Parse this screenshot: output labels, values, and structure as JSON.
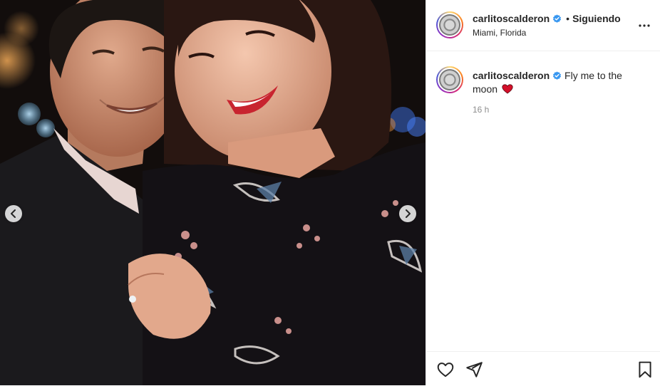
{
  "post": {
    "photo_alt": "Couple smiling at night",
    "prev_icon": "chevron-left-icon",
    "next_icon": "chevron-right-icon"
  },
  "header": {
    "username": "carlitoscalderon",
    "separator": "•",
    "follow_status": "Siguiendo",
    "location": "Miami, Florida",
    "more_icon": "more-options-icon"
  },
  "caption": {
    "username": "carlitoscalderon",
    "text": "Fly me to the moon",
    "emoji": "red-heart",
    "time": "16 h"
  },
  "actions": {
    "like_icon": "heart-icon",
    "share_icon": "paper-plane-icon",
    "save_icon": "bookmark-icon"
  },
  "colors": {
    "verified": "#3897f0",
    "heart": "#d4102a",
    "border": "#efefef",
    "muted": "#8e8e8e"
  }
}
